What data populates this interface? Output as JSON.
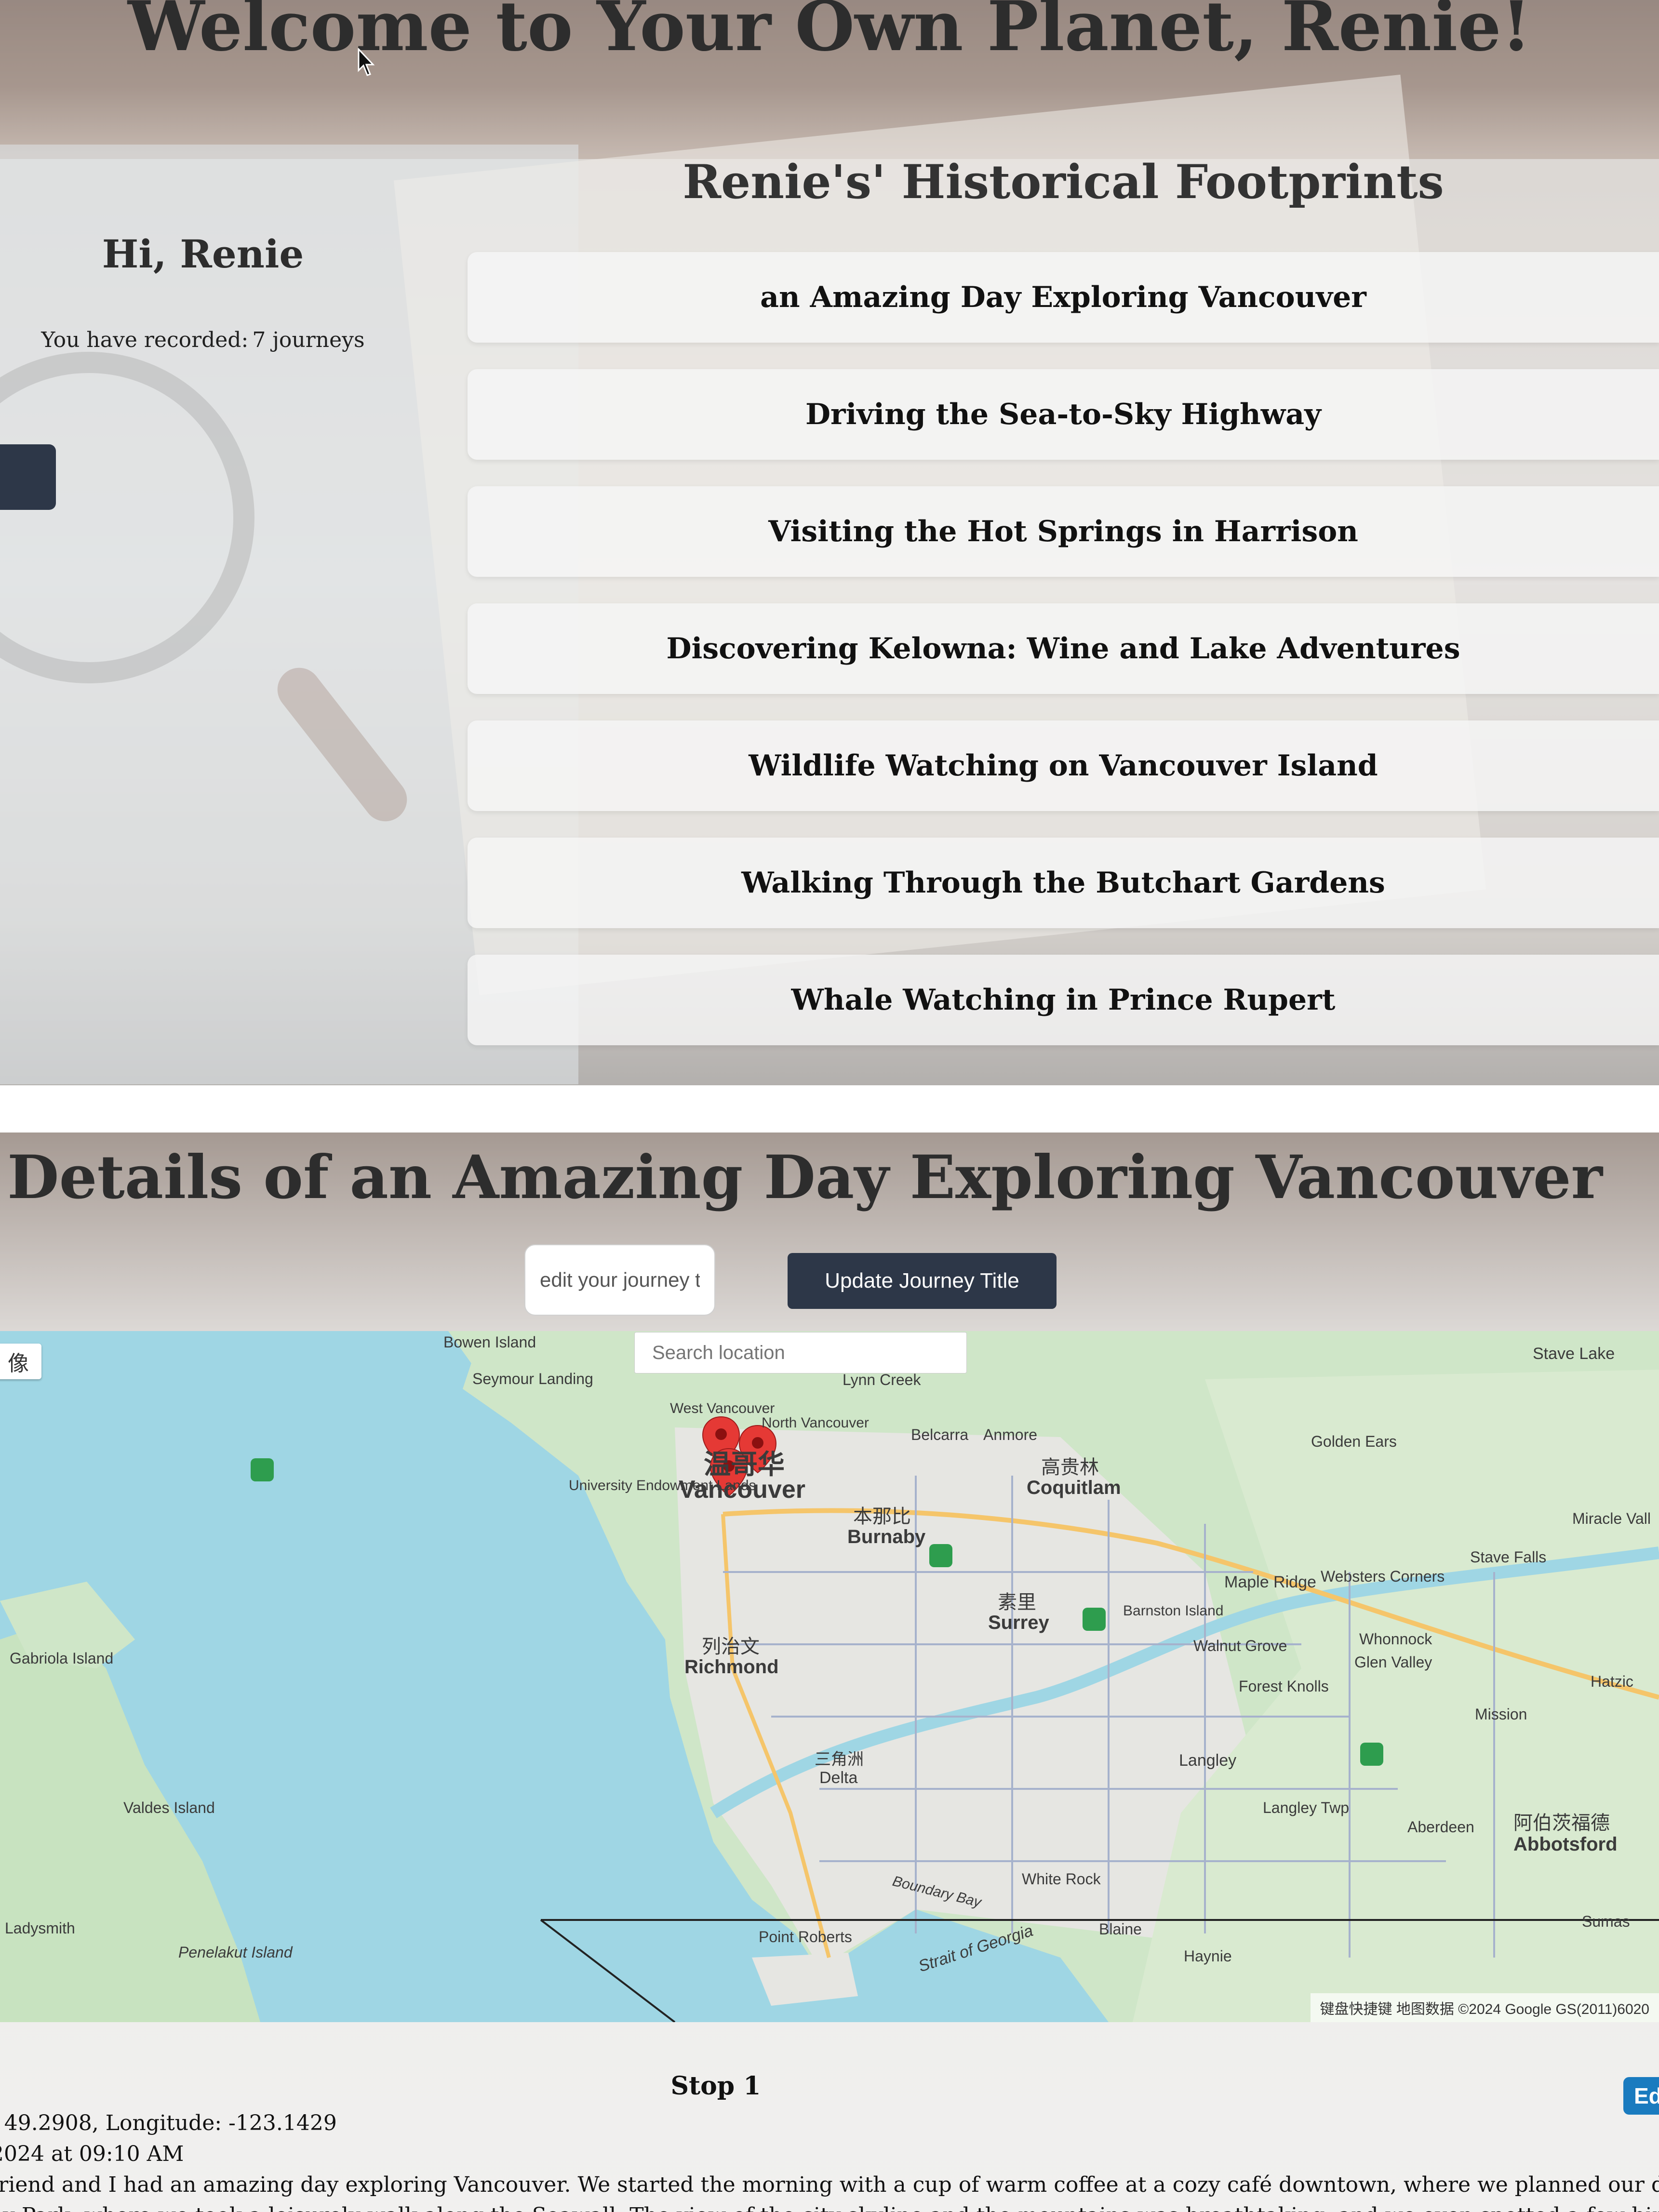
{
  "hero": {
    "welcome_title": "Welcome to Your Own Planet, Renie!",
    "greeting": "Hi, Renie",
    "recorded_label": "You have recorded:",
    "recorded_count": "7 journeys",
    "footprints_title": "Renie's' Historical Footprints",
    "journeys": [
      "an Amazing Day Exploring Vancouver",
      "Driving the Sea-to-Sky Highway",
      "Visiting the Hot Springs in Harrison",
      "Discovering Kelowna: Wine and Lake Adventures",
      "Wildlife Watching on Vancouver Island",
      "Walking Through the Butchart Gardens",
      "Whale Watching in Prince Rupert"
    ]
  },
  "details": {
    "title": "Details of an Amazing Day Exploring Vancouver",
    "title_input_placeholder": "edit your journey title",
    "update_button_label": "Update Journey Title"
  },
  "map": {
    "search_placeholder": "Search location",
    "map_type_label": "像",
    "attribution": "键盘快捷键   地图数据 ©2024 Google GS(2011)6020",
    "labels": {
      "vancouver_cn": "温哥华",
      "vancouver": "Vancouver",
      "burnaby_cn": "本那比",
      "burnaby": "Burnaby",
      "coquitlam_cn": "高贵林",
      "coquitlam": "Coquitlam",
      "surrey_cn": "素里",
      "surrey": "Surrey",
      "richmond_cn": "列治文",
      "richmond": "Richmond",
      "delta_cn": "三角洲",
      "delta": "Delta",
      "langley": "Langley",
      "abbotsford_cn": "阿伯茨福德",
      "abbotsford": "Abbotsford",
      "maple_ridge": "Maple Ridge",
      "white_rock": "White Rock",
      "point_roberts": "Point Roberts",
      "bowen_island": "Bowen Island",
      "lynn_creek": "Lynn Creek",
      "seymour_landing": "Seymour Landing",
      "belcarra": "Belcarra",
      "anmore": "Anmore",
      "gabriola_island": "Gabriola Island",
      "valdes_island": "Valdes Island",
      "ladysmith": "Ladysmith",
      "penelakut_island": "Penelakut Island",
      "strait_of_georgia": "Strait of Georgia",
      "boundary_bay": "Boundary Bay",
      "blaine": "Blaine",
      "mission": "Mission",
      "sumas": "Sumas",
      "stave_lake": "Stave Lake",
      "golden_ears": "Golden Ears",
      "haynie": "Haynie",
      "ubc_endowment_lands": "University Endowment Lands",
      "barnston_island": "Barnston Island",
      "walnut_grove": "Walnut Grove",
      "forest_knolls": "Forest Knolls",
      "langley_twp": "Langley Twp",
      "aldergrove": "Aberdeen",
      "stave_falls": "Stave Falls",
      "websters_corners": "Websters Corners",
      "whonnock": "Whonnock",
      "glen_valley": "Glen Valley",
      "miracle_valley": "Miracle Vall",
      "hatzic": "Hatzic",
      "west_vancouver": "West Vancouver",
      "north_vancouver": "North Vancouver"
    }
  },
  "stop": {
    "title": "Stop 1",
    "coords_line": ": 49.2908, Longitude: -123.1429",
    "time_line": " 2024 at 09:10 AM",
    "description_line1": "friend and I had an amazing day exploring Vancouver. We started the morning with a cup of warm coffee at a cozy café downtown, where we planned our day. Our",
    "description_line2": "ey Park, where we took a leisurely walk along the Seawall. The view of the city skyline and the mountains was breathtaking, and we even spotted a few birds near",
    "edit_button_label": "Ed"
  }
}
